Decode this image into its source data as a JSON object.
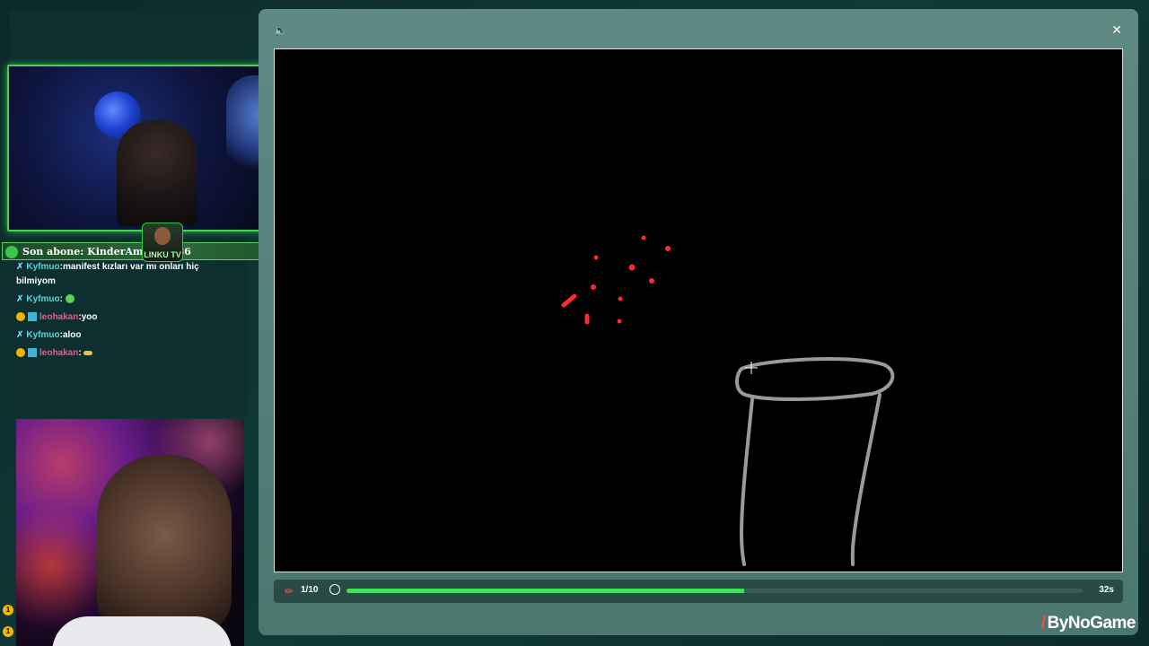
{
  "overlay": {
    "sub_banner": "Son abone: KinderAmDilimi86",
    "streamer_label": "LINKU TV"
  },
  "chat": {
    "messages": [
      {
        "user": "Kyfmuo",
        "text": ":manifest kızları var mı onları hiç bilmiyom"
      },
      {
        "user": "Kyfmuo",
        "text": ":"
      },
      {
        "user": "leohakan",
        "text": ":yoo"
      },
      {
        "user": "Kyfmuo",
        "text": ":aloo"
      },
      {
        "user": "leohakan",
        "text": ":"
      }
    ]
  },
  "coins": [
    "1",
    "1"
  ],
  "game": {
    "round": "1/10",
    "time_left": "32s",
    "progress_fraction": 0.54,
    "brand": "ByNoGame",
    "stroke_colors": {
      "red": "#ff2a2a",
      "gray": "#9a9a9a"
    }
  },
  "icons": {
    "sound": "speaker-icon",
    "close": "close-icon",
    "pencil": "pencil-icon",
    "timer": "timer-icon"
  }
}
